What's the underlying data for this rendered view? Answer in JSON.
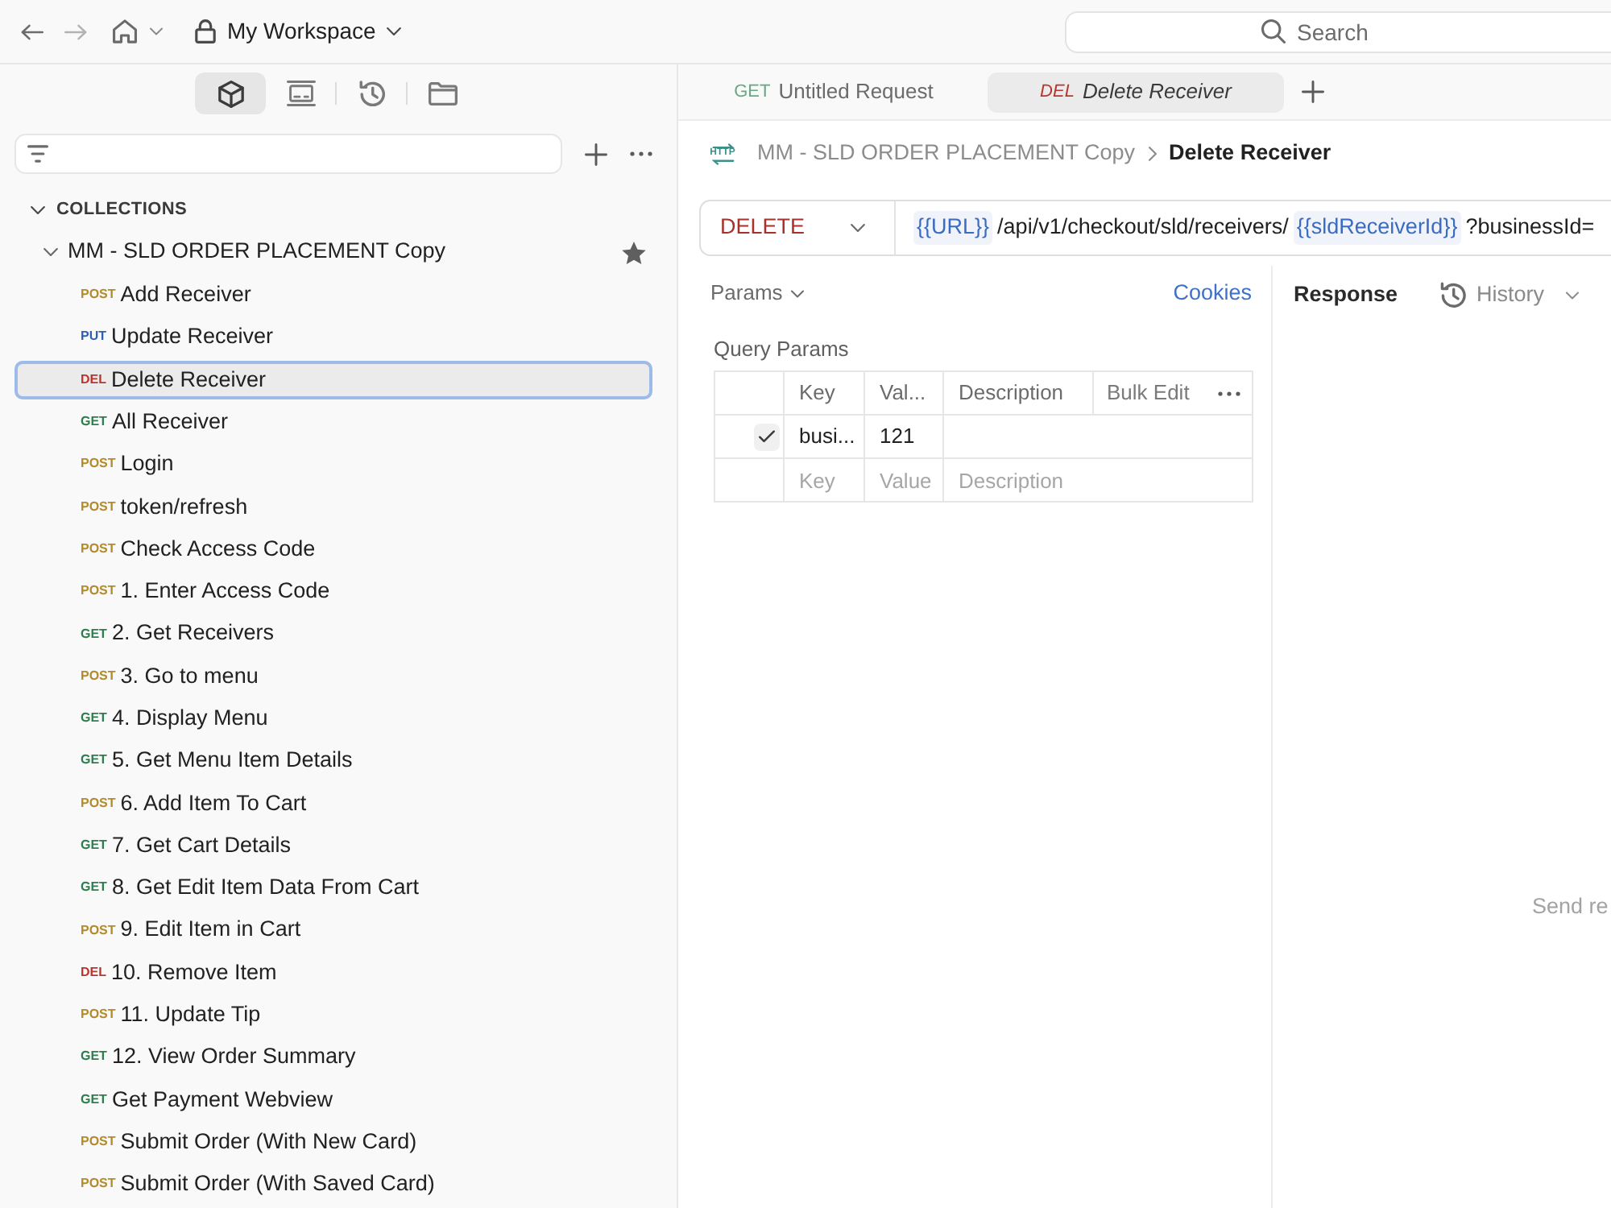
{
  "topbar": {
    "workspace": "My Workspace",
    "search": {
      "placeholder": "Search"
    }
  },
  "sidebar": {
    "views": [
      {
        "kind": "collections",
        "selected": true
      },
      {
        "kind": "environments",
        "selected": false
      },
      {
        "kind": "history",
        "selected": false
      },
      {
        "kind": "files",
        "selected": false
      }
    ],
    "section": {
      "label": "COLLECTIONS",
      "expanded": true
    },
    "collection": {
      "name": "MM - SLD ORDER PLACEMENT Copy",
      "expanded": true,
      "starred": true,
      "items": [
        {
          "method": "POST",
          "color": "#b38b2a",
          "name": "Add Receiver",
          "selected": false
        },
        {
          "method": "PUT",
          "color": "#2f5fb3",
          "name": "Update Receiver",
          "selected": false
        },
        {
          "method": "DEL",
          "color": "#b5372e",
          "name": "Delete Receiver",
          "selected": true
        },
        {
          "method": "GET",
          "color": "#2e7d4f",
          "name": "All Receiver",
          "selected": false
        },
        {
          "method": "POST",
          "color": "#b38b2a",
          "name": "Login",
          "selected": false
        },
        {
          "method": "POST",
          "color": "#b38b2a",
          "name": "token/refresh",
          "selected": false
        },
        {
          "method": "POST",
          "color": "#b38b2a",
          "name": "Check Access Code",
          "selected": false
        },
        {
          "method": "POST",
          "color": "#b38b2a",
          "name": "1. Enter Access Code",
          "selected": false
        },
        {
          "method": "GET",
          "color": "#2e7d4f",
          "name": "2. Get Receivers",
          "selected": false
        },
        {
          "method": "POST",
          "color": "#b38b2a",
          "name": "3. Go to menu",
          "selected": false
        },
        {
          "method": "GET",
          "color": "#2e7d4f",
          "name": "4. Display Menu",
          "selected": false
        },
        {
          "method": "GET",
          "color": "#2e7d4f",
          "name": "5. Get Menu Item Details",
          "selected": false
        },
        {
          "method": "POST",
          "color": "#b38b2a",
          "name": "6. Add Item To Cart",
          "selected": false
        },
        {
          "method": "GET",
          "color": "#2e7d4f",
          "name": "7. Get Cart Details",
          "selected": false
        },
        {
          "method": "GET",
          "color": "#2e7d4f",
          "name": "8. Get Edit Item Data From Cart",
          "selected": false
        },
        {
          "method": "POST",
          "color": "#b38b2a",
          "name": "9. Edit Item in Cart",
          "selected": false
        },
        {
          "method": "DEL",
          "color": "#b5372e",
          "name": "10. Remove Item",
          "selected": false
        },
        {
          "method": "POST",
          "color": "#b38b2a",
          "name": "11. Update Tip",
          "selected": false
        },
        {
          "method": "GET",
          "color": "#2e7d4f",
          "name": "12. View Order Summary",
          "selected": false
        },
        {
          "method": "GET",
          "color": "#2e7d4f",
          "name": "Get Payment Webview",
          "selected": false
        },
        {
          "method": "POST",
          "color": "#b38b2a",
          "name": "Submit Order (With New Card)",
          "selected": false
        },
        {
          "method": "POST",
          "color": "#b38b2a",
          "name": "Submit Order (With Saved Card)",
          "selected": false
        }
      ]
    }
  },
  "tabs": [
    {
      "method": "GET",
      "color": "#6aa883",
      "label": "Untitled Request",
      "selected": false,
      "preview": false
    },
    {
      "method": "DEL",
      "color": "#b5372e",
      "label": "Delete Receiver",
      "selected": true,
      "preview": true
    }
  ],
  "breadcrumb": {
    "icon_label": "HTTP",
    "collection": "MM - SLD ORDER PLACEMENT Copy",
    "request": "Delete Receiver"
  },
  "request": {
    "method": "DELETE",
    "color": "#a8322b",
    "url": [
      {
        "kind": "variable",
        "text": "{{URL}}"
      },
      {
        "kind": "text",
        "text": "/api/v1/checkout/sld/receivers/"
      },
      {
        "kind": "variable",
        "text": "{{sldReceiverId}}"
      },
      {
        "kind": "text",
        "text": "?businessId="
      }
    ]
  },
  "params": {
    "menu": "Params",
    "cookies": "Cookies",
    "title": "Query Params",
    "columns": [
      "Key",
      "Val...",
      "Description"
    ],
    "bulk_edit": "Bulk Edit",
    "rows": [
      {
        "checked": true,
        "key": "busi...",
        "value": "121"
      }
    ],
    "new_row": {
      "key": {
        "placeholder": "Key"
      },
      "value": {
        "placeholder": "Value"
      },
      "description": {
        "placeholder": "Description"
      }
    }
  },
  "response": {
    "title": "Response",
    "history": "History",
    "message": "Send re"
  }
}
